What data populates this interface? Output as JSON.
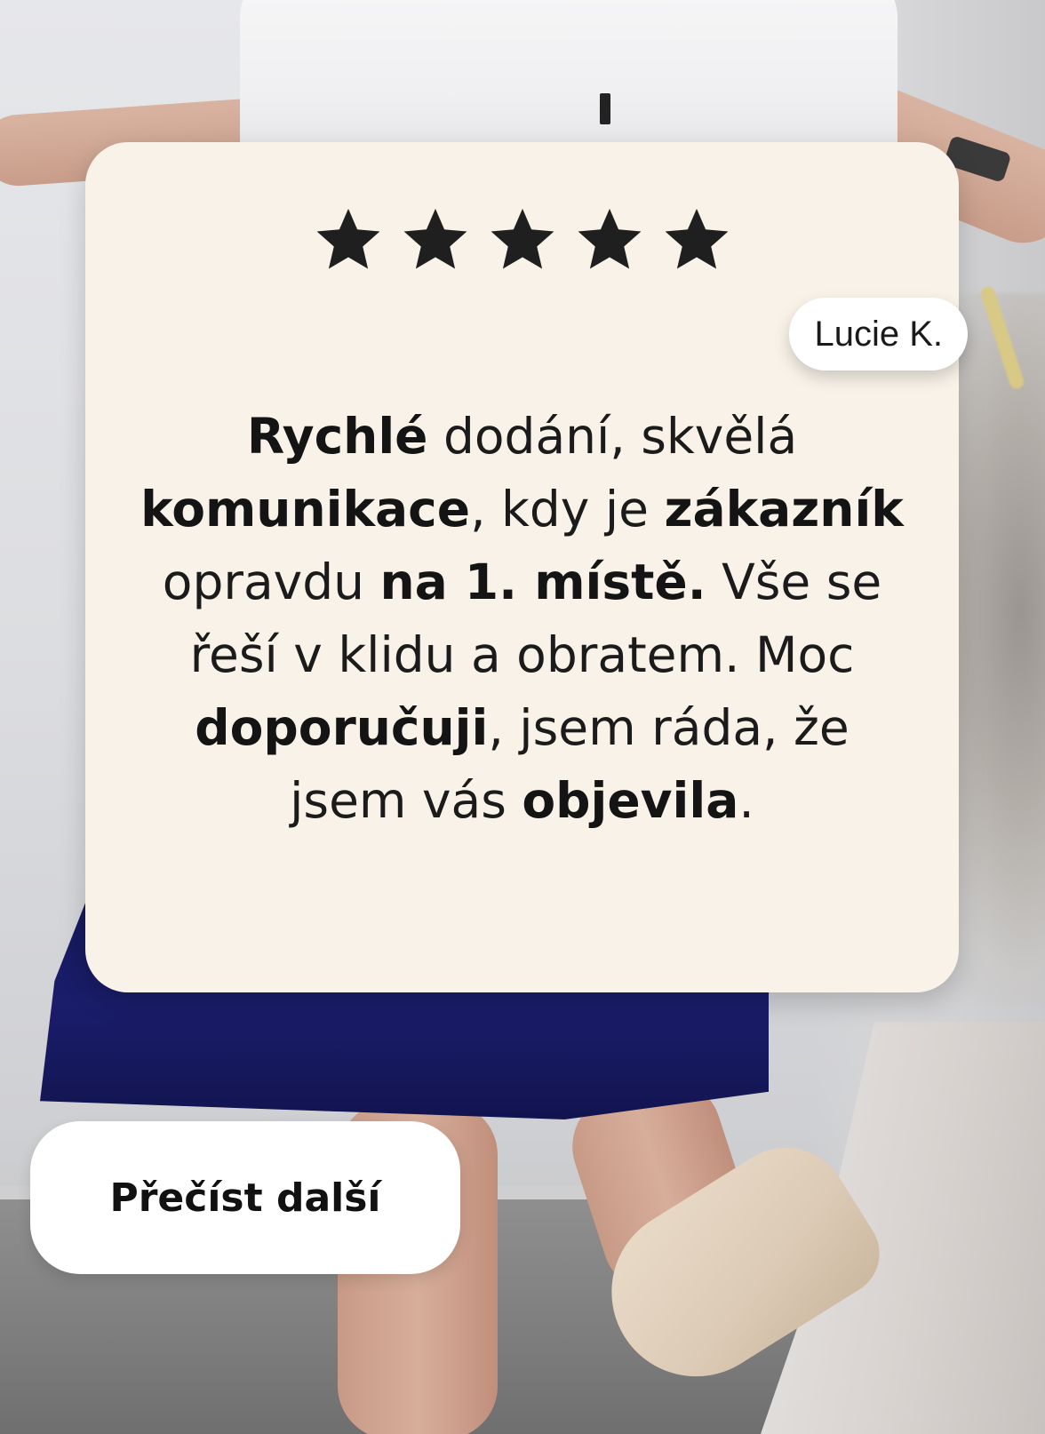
{
  "review": {
    "rating": 5,
    "rating_max": 5,
    "author": "Lucie K.",
    "text_segments": [
      {
        "line": 1,
        "parts": [
          {
            "t": "Rychlé",
            "b": true
          },
          {
            "t": " dodání, skvělá",
            "b": false
          }
        ]
      },
      {
        "line": 2,
        "parts": [
          {
            "t": "komunikace",
            "b": true
          },
          {
            "t": ", kdy je ",
            "b": false
          },
          {
            "t": "zákazník",
            "b": true
          }
        ]
      },
      {
        "line": 3,
        "parts": [
          {
            "t": "opravdu ",
            "b": false
          },
          {
            "t": "na 1. místě.",
            "b": true
          },
          {
            "t": " Vše se",
            "b": false
          }
        ]
      },
      {
        "line": 4,
        "parts": [
          {
            "t": "řeší v klidu a obratem. Moc",
            "b": false
          }
        ]
      },
      {
        "line": 5,
        "parts": [
          {
            "t": "doporučuji",
            "b": true
          },
          {
            "t": ", jsem ráda, že",
            "b": false
          }
        ]
      },
      {
        "line": 6,
        "parts": [
          {
            "t": "jsem vás ",
            "b": false
          },
          {
            "t": "objevila",
            "b": true
          },
          {
            "t": ".",
            "b": false
          }
        ]
      }
    ]
  },
  "actions": {
    "read_more_label": "Přečíst další"
  },
  "colors": {
    "card_background": "#f8f2e8",
    "star_color": "#1f1f1f",
    "button_background": "#ffffff",
    "text_color": "#1b1b1b"
  },
  "icons": {
    "star": "star-icon"
  }
}
